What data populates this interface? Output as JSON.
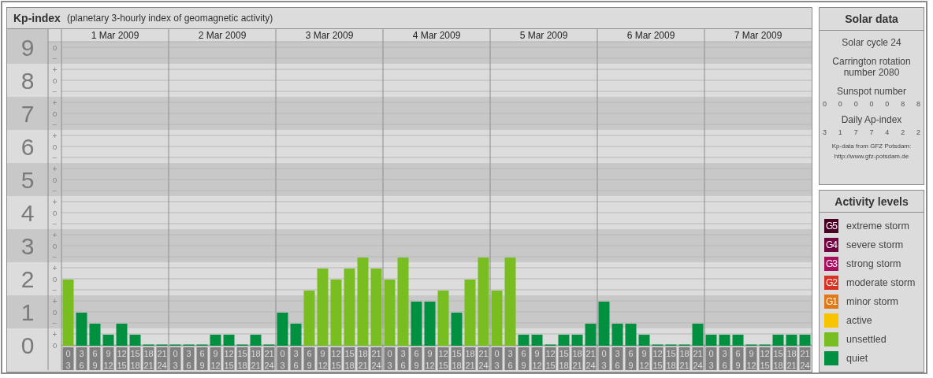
{
  "kp_panel": {
    "title": "Kp-index",
    "subtitle": "(planetary 3-hourly index of geomagnetic activity)",
    "sub_marks": [
      "o",
      "−",
      "+",
      "o",
      "−",
      "+",
      "o",
      "−",
      "+",
      "o",
      "−",
      "+",
      "o",
      "−",
      "+",
      "o",
      "−",
      "+",
      "o",
      "−",
      "+",
      "o",
      "−",
      "+",
      "o",
      "−",
      "+",
      "o"
    ],
    "days": [
      {
        "date": "1 Mar 2009",
        "slots": [
          [
            "0",
            "3"
          ],
          [
            "3",
            "6"
          ],
          [
            "6",
            "9"
          ],
          [
            "9",
            "12"
          ],
          [
            "12",
            "15"
          ],
          [
            "15",
            "18"
          ],
          [
            "18",
            "21"
          ],
          [
            "21",
            "24"
          ]
        ]
      },
      {
        "date": "2 Mar 2009",
        "slots": [
          [
            "0",
            "3"
          ],
          [
            "3",
            "6"
          ],
          [
            "6",
            "9"
          ],
          [
            "9",
            "12"
          ],
          [
            "12",
            "15"
          ],
          [
            "15",
            "18"
          ],
          [
            "18",
            "21"
          ],
          [
            "21",
            "24"
          ]
        ]
      },
      {
        "date": "3 Mar 2009",
        "slots": [
          [
            "0",
            "3"
          ],
          [
            "3",
            "6"
          ],
          [
            "6",
            "9"
          ],
          [
            "9",
            "12"
          ],
          [
            "12",
            "15"
          ],
          [
            "15",
            "18"
          ],
          [
            "18",
            "21"
          ],
          [
            "21",
            "24"
          ]
        ]
      },
      {
        "date": "4 Mar 2009",
        "slots": [
          [
            "0",
            "3"
          ],
          [
            "3",
            "6"
          ],
          [
            "6",
            "9"
          ],
          [
            "9",
            "12"
          ],
          [
            "12",
            "15"
          ],
          [
            "15",
            "18"
          ],
          [
            "18",
            "21"
          ],
          [
            "21",
            "24"
          ]
        ]
      },
      {
        "date": "5 Mar 2009",
        "slots": [
          [
            "0",
            "3"
          ],
          [
            "3",
            "6"
          ],
          [
            "6",
            "9"
          ],
          [
            "9",
            "12"
          ],
          [
            "12",
            "15"
          ],
          [
            "15",
            "18"
          ],
          [
            "18",
            "21"
          ],
          [
            "21",
            "24"
          ]
        ]
      },
      {
        "date": "6 Mar 2009",
        "slots": [
          [
            "0",
            "3"
          ],
          [
            "3",
            "6"
          ],
          [
            "6",
            "9"
          ],
          [
            "9",
            "12"
          ],
          [
            "12",
            "15"
          ],
          [
            "15",
            "18"
          ],
          [
            "18",
            "21"
          ],
          [
            "21",
            "24"
          ]
        ]
      },
      {
        "date": "7 Mar 2009",
        "slots": [
          [
            "0",
            "3"
          ],
          [
            "3",
            "6"
          ],
          [
            "6",
            "9"
          ],
          [
            "9",
            "12"
          ],
          [
            "12",
            "15"
          ],
          [
            "15",
            "18"
          ],
          [
            "18",
            "21"
          ],
          [
            "21",
            "24"
          ]
        ]
      }
    ],
    "chart_data": {
      "type": "bar",
      "grid": true,
      "ylim": [
        0,
        9
      ],
      "yticks": [
        0,
        1,
        2,
        3,
        4,
        5,
        6,
        7,
        8,
        9
      ],
      "series": [
        {
          "color": "#009040",
          "values": [
            null,
            1,
            0.67,
            0.33,
            0.67,
            0.33,
            0,
            0,
            0,
            0,
            0,
            0.33,
            0.33,
            0,
            0.33,
            0,
            1,
            0.67,
            null,
            null,
            null,
            null,
            null,
            null,
            null,
            null,
            1.33,
            1.33,
            null,
            1,
            null,
            null,
            null,
            null,
            0.33,
            0.33,
            0,
            0.33,
            0.33,
            0.67,
            1.33,
            0.67,
            0.67,
            0.33,
            0,
            0,
            0,
            0.67,
            0.33,
            0.33,
            0.33,
            0,
            0,
            0.33,
            0.33,
            0.33
          ]
        },
        {
          "color": "#78be20",
          "values": [
            2,
            null,
            null,
            null,
            null,
            null,
            null,
            null,
            null,
            null,
            null,
            null,
            null,
            null,
            null,
            null,
            null,
            null,
            1.67,
            2.33,
            2,
            2.33,
            2.67,
            2.33,
            2,
            2.67,
            null,
            null,
            1.67,
            null,
            2,
            2.67,
            1.67,
            2.67,
            null,
            null,
            null,
            null,
            null,
            null,
            null,
            null,
            null,
            null,
            null,
            null,
            null,
            null,
            null,
            null,
            null,
            null,
            null,
            null,
            null,
            null
          ]
        }
      ]
    }
  },
  "solar_data": {
    "title": "Solar data",
    "solar_cycle": "Solar cycle 24",
    "carrington": "Carrington rotation number 2080",
    "sunspot_label": "Sunspot number",
    "sunspot_values": [
      "0",
      "0",
      "0",
      "0",
      "0",
      "8",
      "8"
    ],
    "ap_label": "Daily Ap-index",
    "ap_values": [
      "3",
      "1",
      "7",
      "7",
      "4",
      "2",
      "2"
    ],
    "source": "Kp-data from GFZ Potsdam:",
    "source_url": "http://www.gfz-potsdam.de"
  },
  "activity_levels": {
    "title": "Activity levels",
    "items": [
      {
        "badge": "G5",
        "label": "extreme storm",
        "color": "#4a0022"
      },
      {
        "badge": "G4",
        "label": "severe storm",
        "color": "#700040"
      },
      {
        "badge": "G3",
        "label": "strong storm",
        "color": "#a8105e"
      },
      {
        "badge": "G2",
        "label": "moderate storm",
        "color": "#d83222"
      },
      {
        "badge": "G1",
        "label": "minor storm",
        "color": "#e07818"
      },
      {
        "label": "active",
        "color": "#f8c400"
      },
      {
        "label": "unsettled",
        "color": "#78be20"
      },
      {
        "label": "quiet",
        "color": "#009040"
      }
    ]
  }
}
